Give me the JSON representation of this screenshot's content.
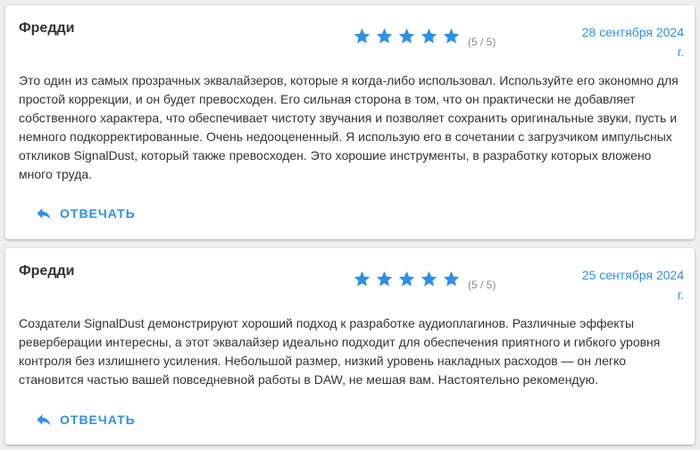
{
  "colors": {
    "accent": "#2d8fe8",
    "star": "#2d8fe8",
    "text": "#333333",
    "muted": "#888888",
    "background": "#eeeeee"
  },
  "reviews": [
    {
      "author": "Фредди",
      "rating": 5,
      "max_rating": 5,
      "score_text": "(5 / 5)",
      "date_line1": "28 сентября 2024",
      "date_line2": "г.",
      "text": "Это один из самых прозрачных эквалайзеров, которые я когда-либо использовал. Используйте его экономно для простой коррекции, и он будет превосходен. Его сильная сторона в том, что он практически не добавляет собственного характера, что обеспечивает чистоту звучания и позволяет сохранить оригинальные звуки, пусть и немного подкорректированные. Очень недооцененный. Я использую его в сочетании с загрузчиком импульсных откликов SignalDust, который также превосходен. Это хорошие инструменты, в разработку которых вложено много труда.",
      "reply_label": "ОТВЕЧАТЬ",
      "reply_icon": "reply-icon"
    },
    {
      "author": "Фредди",
      "rating": 5,
      "max_rating": 5,
      "score_text": "(5 / 5)",
      "date_line1": "25 сентября 2024",
      "date_line2": "г.",
      "text": "Создатели SignalDust демонстрируют хороший подход к разработке аудиоплагинов. Различные эффекты реверберации интересны, а этот эквалайзер идеально подходит для обеспечения приятного и гибкого уровня контроля без излишнего усиления. Небольшой размер, низкий уровень накладных расходов — он легко становится частью вашей повседневной работы в DAW, не мешая вам. Настоятельно рекомендую.",
      "reply_label": "ОТВЕЧАТЬ",
      "reply_icon": "reply-icon"
    }
  ]
}
